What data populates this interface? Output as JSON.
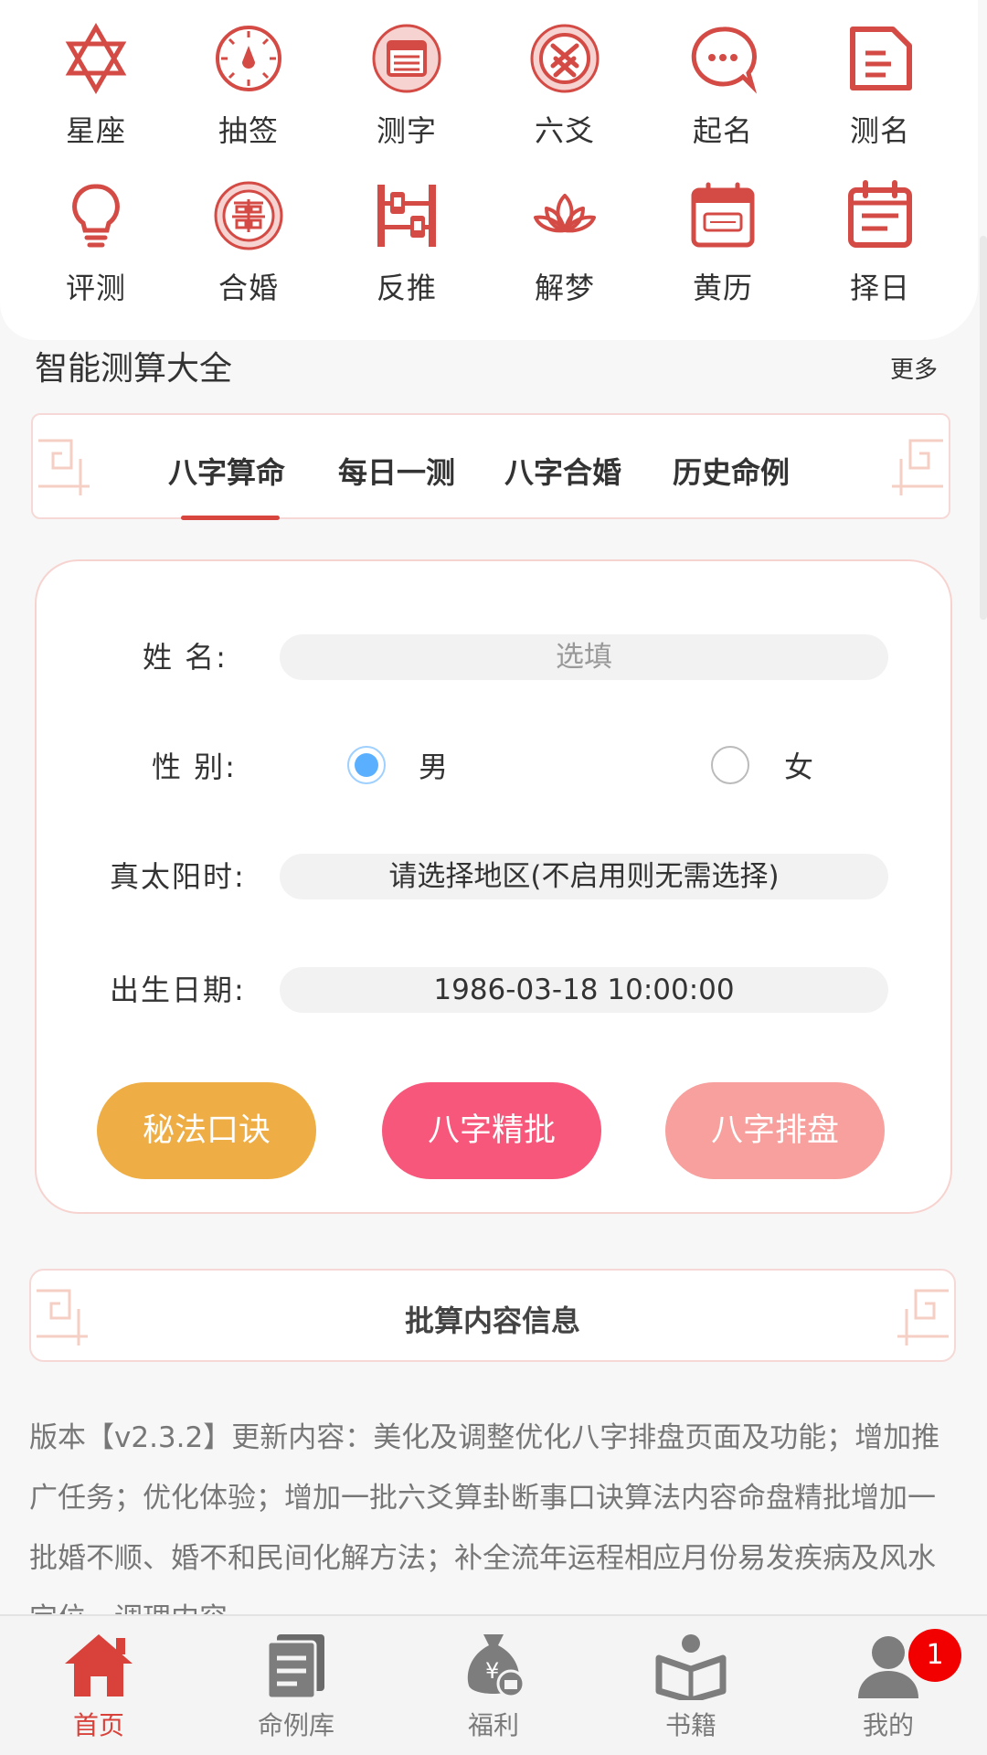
{
  "grid": [
    {
      "label": "星座",
      "icon": "star-of-david-icon"
    },
    {
      "label": "抽签",
      "icon": "fortune-dial-icon"
    },
    {
      "label": "测字",
      "icon": "character-form-icon"
    },
    {
      "label": "六爻",
      "icon": "yao-coin-icon"
    },
    {
      "label": "起名",
      "icon": "chat-bubble-icon"
    },
    {
      "label": "测名",
      "icon": "document-icon"
    },
    {
      "label": "评测",
      "icon": "lightbulb-icon"
    },
    {
      "label": "合婚",
      "icon": "double-happiness-icon"
    },
    {
      "label": "反推",
      "icon": "abacus-icon"
    },
    {
      "label": "解梦",
      "icon": "lotus-icon"
    },
    {
      "label": "黄历",
      "icon": "almanac-calendar-icon"
    },
    {
      "label": "择日",
      "icon": "date-select-icon"
    }
  ],
  "section": {
    "title": "智能测算大全",
    "more": "更多"
  },
  "tabs": [
    "八字算命",
    "每日一测",
    "八字合婚",
    "历史命例"
  ],
  "form": {
    "name_label": "姓 名:",
    "name_placeholder": "选填",
    "gender_label": "性 别:",
    "gender_male": "男",
    "gender_female": "女",
    "gender_selected": "男",
    "solar_label": "真太阳时:",
    "solar_value": "请选择地区(不启用则无需选择)",
    "birth_label": "出生日期:",
    "birth_value": "1986-03-18 10:00:00",
    "btn_secret": "秘法口诀",
    "btn_detail": "八字精批",
    "btn_chart": "八字排盘"
  },
  "info": {
    "title": "批算内容信息"
  },
  "notes": "版本【v2.3.2】更新内容：美化及调整优化八字排盘页面及功能；增加推广任务；优化体验；增加一批六爻算卦断事口诀算法内容命盘精批增加一批婚不顺、婚不和民间化解方法；补全流年运程相应月份易发疾病及风水定位、调理内容",
  "tabbar": [
    {
      "label": "首页",
      "icon": "home-icon",
      "active": true
    },
    {
      "label": "命例库",
      "icon": "case-library-icon",
      "active": false
    },
    {
      "label": "福利",
      "icon": "money-bag-icon",
      "active": false
    },
    {
      "label": "书籍",
      "icon": "reader-book-icon",
      "active": false
    },
    {
      "label": "我的",
      "icon": "user-icon",
      "active": false,
      "badge": "1"
    }
  ],
  "colors": {
    "accent": "#d8453f",
    "icon_red": "#d44a44",
    "btn_secret": "#eeae45",
    "btn_detail": "#f6577a",
    "btn_chart": "#f7a09d",
    "radio_checked": "#5ab0ff",
    "badge": "#f20000"
  }
}
